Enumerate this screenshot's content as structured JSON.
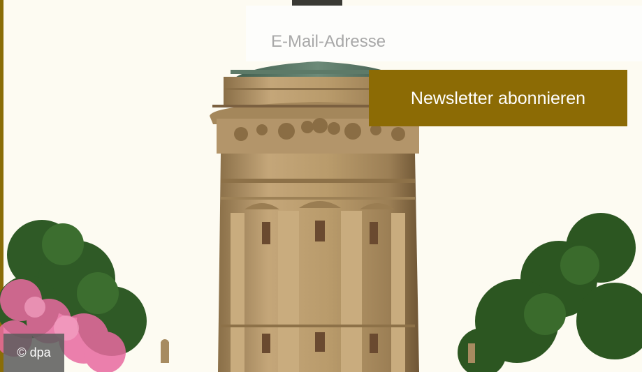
{
  "newsletter": {
    "email_placeholder": "E-Mail-Adresse",
    "subscribe_label": "Newsletter abonnieren"
  },
  "photo": {
    "credit": "© dpa"
  },
  "colors": {
    "accent": "#8c6b05",
    "background": "#fdfbf2",
    "stone": "#b99b6b"
  }
}
